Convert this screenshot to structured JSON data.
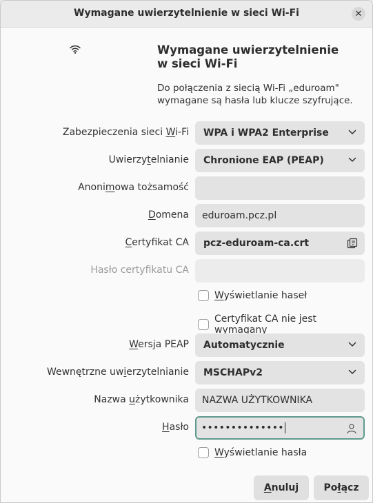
{
  "window": {
    "title": "Wymagane uwierzytelnienie w sieci Wi-Fi",
    "close_glyph": "✕"
  },
  "header": {
    "icon": "wifi-icon",
    "title_line1": "Wymagane uwierzytelnienie",
    "title_line2": "w sieci Wi-Fi",
    "desc_line1": "Do połączenia z siecią Wi-Fi „eduroam\"",
    "desc_line2": "wymagane są hasła lub klucze szyfrujące."
  },
  "form": {
    "security": {
      "label_a": "Zabezpieczenia sieci ",
      "label_u": "W",
      "label_b": "i-Fi",
      "value": "WPA i WPA2 Enterprise"
    },
    "auth": {
      "label_a": "Uwierzy",
      "label_u": "t",
      "label_b": "elnianie",
      "value": "Chronione EAP (PEAP)"
    },
    "anon": {
      "label_a": "Anoni",
      "label_u": "m",
      "label_b": "owa tożsamość",
      "value": ""
    },
    "domain": {
      "label_a": "",
      "label_u": "D",
      "label_b": "omena",
      "value": "eduroam.pcz.pl"
    },
    "ca_cert": {
      "label_a": "",
      "label_u": "C",
      "label_b": "ertyfikat CA",
      "value": "pcz-eduroam-ca.crt",
      "icon": "file-chooser-icon"
    },
    "ca_password": {
      "label": "Hasło certyfikatu CA",
      "value": ""
    },
    "show_passwords": {
      "label_a": "",
      "label_u": "W",
      "label_b": "yświetlanie haseł",
      "checked": false
    },
    "no_ca_required": {
      "label_a": "Certyfikat CA nie jest ",
      "label_u": "w",
      "label_b": "ymagany",
      "checked": false
    },
    "peap_version": {
      "label_a": "",
      "label_u": "W",
      "label_b": "ersja PEAP",
      "value": "Automatycznie"
    },
    "inner_auth": {
      "label_a": "Wewnętrzne uw",
      "label_u": "i",
      "label_b": "erzytelnianie",
      "value": "MSCHAPv2"
    },
    "username": {
      "label_a": "Nazwa ",
      "label_u": "u",
      "label_b": "żytkownika",
      "value": "NAZWA UŻYTKOWNIKA"
    },
    "password": {
      "label_a": "",
      "label_u": "H",
      "label_b": "asło",
      "value": "••••••••••••••",
      "icon": "user-icon"
    },
    "show_password": {
      "label_a": "",
      "label_u": "W",
      "label_b": "yświetlanie hasła",
      "checked": false
    }
  },
  "buttons": {
    "cancel": {
      "label_u": "A",
      "label_b": "nuluj"
    },
    "connect": {
      "label_a": "Po",
      "label_u": "ł",
      "label_b": "ącz"
    }
  },
  "colors": {
    "accent_focus": "#5d9a8c",
    "field_bg": "#e3e3e3",
    "window_bg": "#fafafa"
  }
}
